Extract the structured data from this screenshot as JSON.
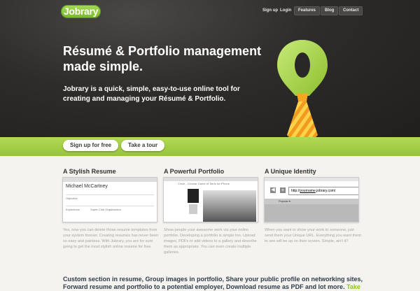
{
  "header": {
    "logo_text": "Jobrary",
    "nav": [
      "Sign up",
      "Login"
    ],
    "nav_buttons": [
      "Features",
      "Blog",
      "Contact"
    ]
  },
  "hero": {
    "headline": "Résumé & Portfolio management made simple.",
    "subtitle": "Jobrary is a quick, simple, easy-to-use online tool for creating and managing your Résumé & Portfolio."
  },
  "cta": {
    "signup": "Sign up for free",
    "tour": "Take a tour"
  },
  "features": [
    {
      "title": "A Stylish Resume",
      "text": "Yes, now you can delete those resume templates from your system forever. Creating resumes has never been so easy and painless. With Jobrary, you are for sure going to get the most stylish online resume for free.",
      "shot": {
        "name": "Michael McCartney",
        "rows": [
          "Objective",
          "Experience"
        ],
        "item": "Super Club Organization"
      }
    },
    {
      "title": "A Powerful Portfolio",
      "text": "Show people your awesome work via your online portfolio. Developing a portfolio is simple too. Upload images, PDFs or add videos to a gallery and describe them as appropriate. You can even create multiple galleries.",
      "shot": {
        "caption": "Circle - Circular Game of Tetris for iPhone"
      }
    },
    {
      "title": "A Unique Identity",
      "text": "When you want to show your work to someone, just send them your Unique URL. Everything you want them to see will be up on their screen. Simple, ain't it?",
      "shot": {
        "url_prefix": "http://",
        "url_highlight": "yourname",
        "url_suffix": ".jobrary.com/",
        "menu": "Popular ▾"
      }
    }
  ],
  "bottom": {
    "text": "Custom section in resume, Group images in portfolio, Share your public profile on networking sites, Forward resume and portfolio to a potential employer, Download resume as PDF and lot more.",
    "link": "Take"
  },
  "colors": {
    "accent": "#98c43c",
    "hero_bg": "#2e2c2a",
    "tie_orange": "#f6a623"
  },
  "icons": [
    "tie-mascot-icon",
    "plus-icon",
    "back-icon"
  ]
}
